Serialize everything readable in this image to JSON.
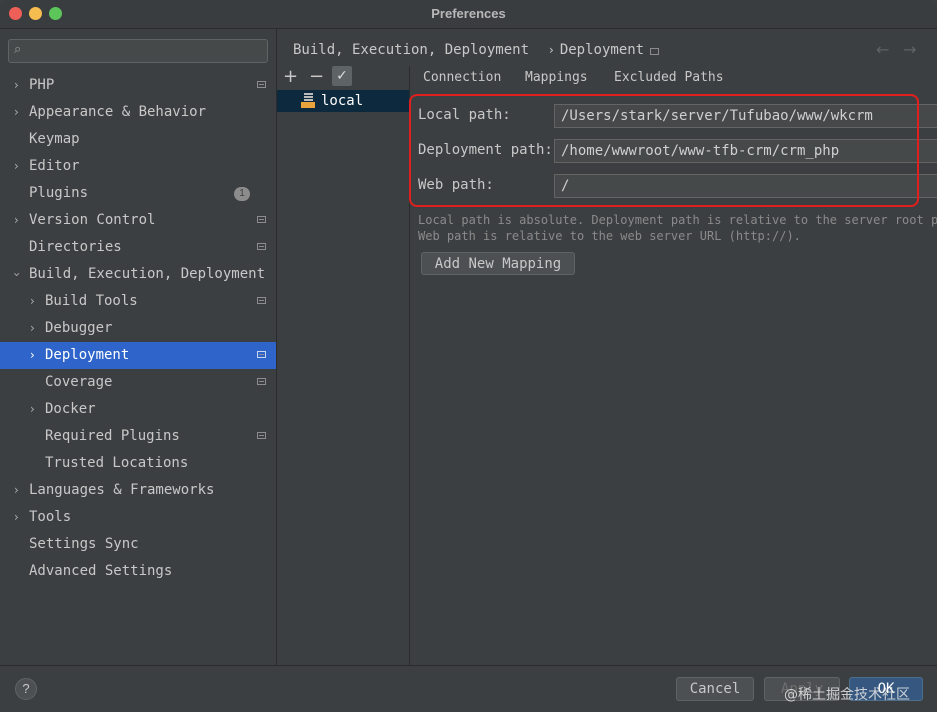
{
  "window": {
    "title": "Preferences"
  },
  "sidebar": {
    "search_placeholder": "",
    "items": [
      {
        "label": "PHP"
      },
      {
        "label": "Appearance & Behavior"
      },
      {
        "label": "Keymap"
      },
      {
        "label": "Editor"
      },
      {
        "label": "Plugins",
        "badge": "1"
      },
      {
        "label": "Version Control"
      },
      {
        "label": "Directories"
      },
      {
        "label": "Build, Execution, Deployment"
      },
      {
        "label": "Build Tools"
      },
      {
        "label": "Debugger"
      },
      {
        "label": "Deployment",
        "selected": true
      },
      {
        "label": "Coverage"
      },
      {
        "label": "Docker"
      },
      {
        "label": "Required Plugins"
      },
      {
        "label": "Trusted Locations"
      },
      {
        "label": "Languages & Frameworks"
      },
      {
        "label": "Tools"
      },
      {
        "label": "Settings Sync"
      },
      {
        "label": "Advanced Settings"
      }
    ]
  },
  "header": {
    "breadcrumb_parent": "Build, Execution, Deployment",
    "breadcrumb_separator": "›",
    "breadcrumb_current": "Deployment"
  },
  "servers": {
    "add": "+",
    "remove": "−",
    "default": "✓",
    "items": [
      {
        "label": "local",
        "icon": "sftp-server-icon"
      }
    ]
  },
  "tabs": [
    {
      "label": "Connection"
    },
    {
      "label": "Mappings",
      "active": true
    },
    {
      "label": "Excluded Paths"
    }
  ],
  "mapping": {
    "local_path_label": "Local path:",
    "local_path_value": "/Users/stark/server/Tufubao/www/wkcrm",
    "deployment_path_label": "Deployment path:",
    "deployment_path_value": "/home/wwwroot/www-tfb-crm/crm_php",
    "web_path_label": "Web path:",
    "web_path_value": "/",
    "hint_line1": "Local path is absolute. Deployment path is relative to the server root p",
    "hint_line2": "Web path is relative to the web server URL (http://).",
    "add_mapping_label": "Add New Mapping"
  },
  "footer": {
    "help": "?",
    "cancel_label": "Cancel",
    "apply_label": "Apply",
    "ok_label": "OK",
    "watermark": "@稀土掘金技术社区"
  },
  "colors": {
    "selection": "#2f65ca",
    "highlight_box": "#e0201e",
    "background": "#3c3f41"
  }
}
